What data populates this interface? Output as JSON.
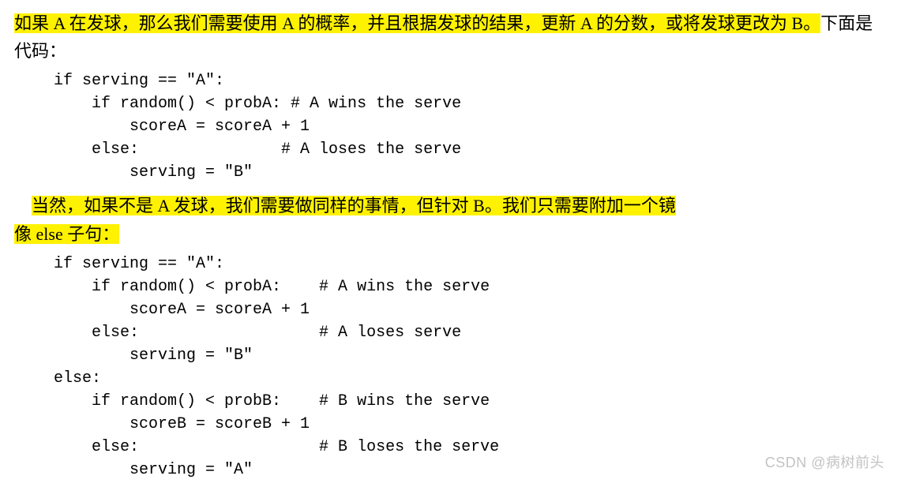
{
  "paragraph1": {
    "highlight_part": "如果 A 在发球，那么我们需要使用 A 的概率，并且根据发球的结果，更新 A 的分数，或将发球更改为 B。",
    "plain_part": "下面是代码："
  },
  "code1": "if serving == \"A\":\n    if random() < probA: # A wins the serve\n        scoreA = scoreA + 1\n    else:               # A loses the serve\n        serving = \"B\"",
  "paragraph2": {
    "highlight_part1": "当然，如果不是 A 发球，我们需要做同样的事情，但针对 B。我们只需要附加一个镜",
    "highlight_part2": "像 else 子句："
  },
  "code2": "if serving == \"A\":\n    if random() < probA:    # A wins the serve\n        scoreA = scoreA + 1\n    else:                   # A loses serve\n        serving = \"B\"\nelse:\n    if random() < probB:    # B wins the serve\n        scoreB = scoreB + 1\n    else:                   # B loses the serve\n        serving = \"A\"",
  "watermark": "CSDN @病树前头"
}
